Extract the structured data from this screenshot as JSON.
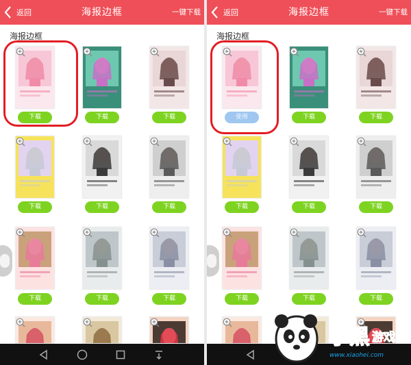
{
  "panels": [
    {
      "header": {
        "back_label": "返回",
        "title": "海报边框",
        "action_label": "一键下载"
      },
      "section_title": "海报边框",
      "first_button_label": "下载"
    },
    {
      "header": {
        "back_label": "返回",
        "title": "海报边框",
        "action_label": "一键下载"
      },
      "section_title": "海报边框",
      "first_button_label": "使用"
    }
  ],
  "download_label": "下载",
  "colors": {
    "header_bg": "#ef4f58",
    "download_button": "#7ed321",
    "use_button": "#9fc7ef",
    "highlight_circle": "#e21d24"
  },
  "watermark": {
    "brand": "小黑游戏",
    "url": "www.xiaohei.com"
  },
  "icons": {
    "back": "chevron-left-icon",
    "zoom": "zoom-in-icon",
    "nav": [
      "back-triangle-icon",
      "home-circle-icon",
      "recents-square-icon",
      "notification-pull-icon"
    ]
  }
}
